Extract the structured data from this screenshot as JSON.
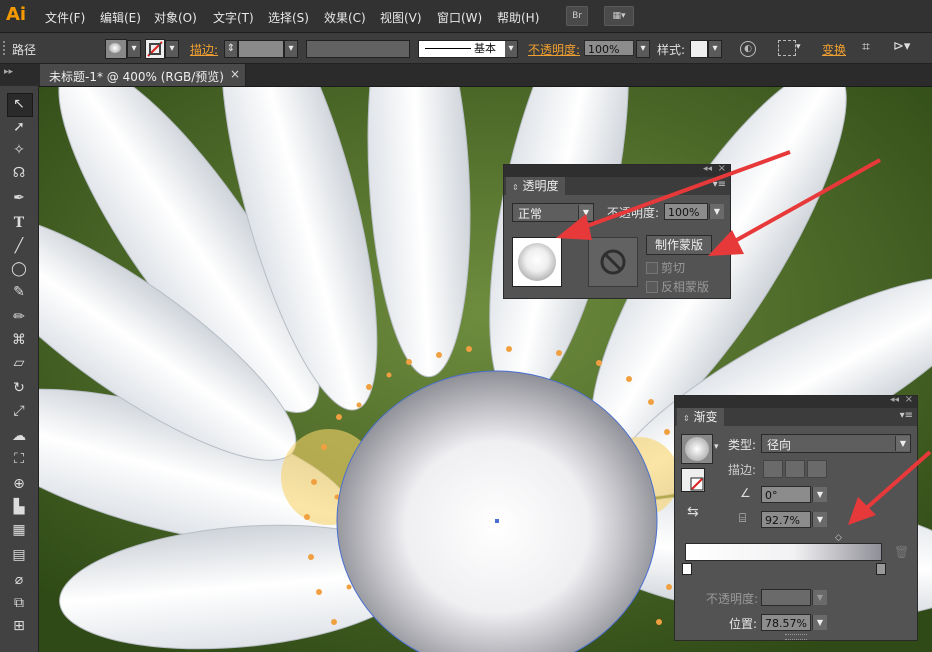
{
  "app": {
    "logo": "Ai"
  },
  "menu": {
    "items": [
      "文件(F)",
      "编辑(E)",
      "对象(O)",
      "文字(T)",
      "选择(S)",
      "效果(C)",
      "视图(V)",
      "窗口(W)",
      "帮助(H)"
    ],
    "bridge_label": "Br"
  },
  "control_bar": {
    "object_type": "路径",
    "stroke_label": "描边:",
    "stroke_style": "基本",
    "opacity_label": "不透明度:",
    "opacity_value": "100%",
    "style_label": "样式:",
    "transform_label": "变换"
  },
  "document_tab": {
    "title": "未标题-1* @ 400% (RGB/预览)",
    "close": "×"
  },
  "transparency_panel": {
    "title": "透明度",
    "blend_mode": "正常",
    "opacity_label": "不透明度:",
    "opacity_value": "100%",
    "make_mask_button": "制作蒙版",
    "clip_label": "剪切",
    "invert_mask_label": "反相蒙版"
  },
  "gradient_panel": {
    "title": "渐变",
    "type_label": "类型:",
    "type_value": "径向",
    "stroke_label": "描边:",
    "angle_value": "0°",
    "aspect_value": "92.7%",
    "opacity_label": "不透明度:",
    "location_label": "位置:",
    "location_value": "78.57%"
  },
  "colors": {
    "accent": "#f79a00",
    "arrow": "#e8393a",
    "panel_bg": "#535353"
  }
}
